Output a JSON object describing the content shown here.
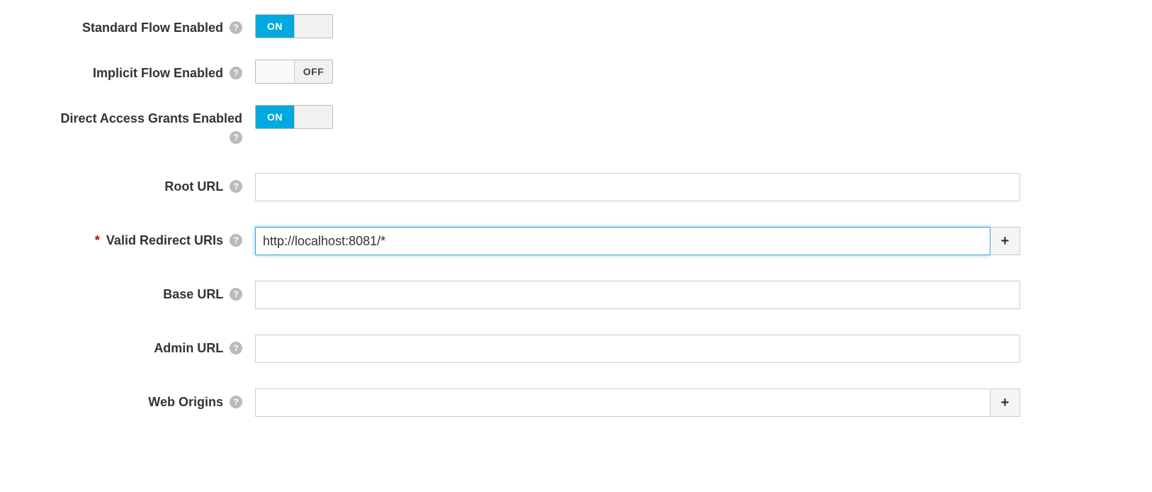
{
  "fields": {
    "standardFlow": {
      "label": "Standard Flow Enabled",
      "state": "on",
      "onText": "ON",
      "offText": "OFF"
    },
    "implicitFlow": {
      "label": "Implicit Flow Enabled",
      "state": "off",
      "onText": "ON",
      "offText": "OFF"
    },
    "directAccess": {
      "label": "Direct Access Grants Enabled",
      "state": "on",
      "onText": "ON",
      "offText": "OFF"
    },
    "rootUrl": {
      "label": "Root URL",
      "value": ""
    },
    "redirectUris": {
      "label": "Valid Redirect URIs",
      "value": "http://localhost:8081/*",
      "required": true,
      "add": "+"
    },
    "baseUrl": {
      "label": "Base URL",
      "value": ""
    },
    "adminUrl": {
      "label": "Admin URL",
      "value": ""
    },
    "webOrigins": {
      "label": "Web Origins",
      "value": "",
      "add": "+"
    }
  },
  "helpGlyph": "?"
}
